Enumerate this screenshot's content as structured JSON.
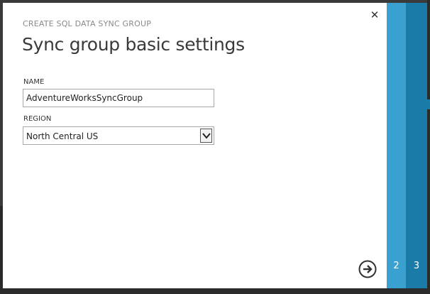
{
  "wizard": {
    "subtitle": "CREATE SQL DATA SYNC GROUP",
    "title": "Sync group basic settings",
    "close_symbol": "✕"
  },
  "form": {
    "name": {
      "label": "NAME",
      "value": "AdventureWorksSyncGroup"
    },
    "region": {
      "label": "REGION",
      "selected": "North Central US"
    }
  },
  "navigation": {
    "next_icon": "arrow-right-circle-icon"
  },
  "steps": {
    "step2": "2",
    "step3": "3"
  },
  "colors": {
    "accent_light": "#3aa0d0",
    "accent_dark": "#1a7ba8"
  }
}
